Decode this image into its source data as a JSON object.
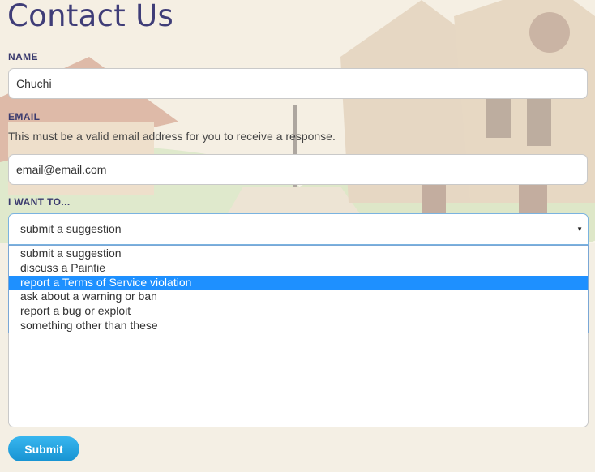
{
  "page": {
    "title": "Contact Us"
  },
  "form": {
    "name": {
      "label": "NAME",
      "value": "Chuchi"
    },
    "email": {
      "label": "EMAIL",
      "help": "This must be a valid email address for you to receive a response.",
      "value": "email@email.com"
    },
    "intent": {
      "label": "I WANT TO...",
      "selected": "submit a suggestion",
      "options": [
        "submit a suggestion",
        "discuss a Paintie",
        "report a Terms of Service violation",
        "ask about a warning or ban",
        "report a bug or exploit",
        "something other than these"
      ],
      "highlighted_option": "report a Terms of Service violation"
    },
    "message": {
      "value": ""
    },
    "submit_label": "Submit"
  },
  "icons": {
    "select_arrow": "chevron-down-icon"
  },
  "colors": {
    "title": "#3f3d78",
    "label": "#3a3a6e",
    "highlight": "#1e90ff",
    "submit": "#1f9fdc"
  }
}
